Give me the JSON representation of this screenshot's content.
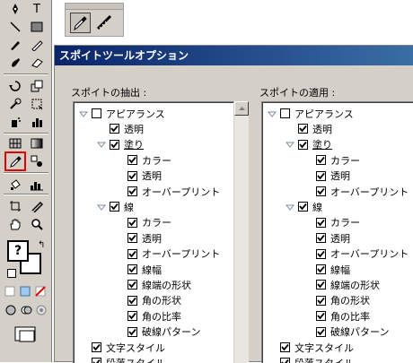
{
  "dialog": {
    "title": "スポイトツールオプション",
    "pick_label": "スポイトの抽出 :",
    "apply_label": "スポイトの適用 :"
  },
  "tree": [
    {
      "label": "アピアランス",
      "checked": false,
      "level": 0,
      "expander": true
    },
    {
      "label": "透明",
      "checked": true,
      "level": 1,
      "expander": false
    },
    {
      "label": "塗り",
      "checked": true,
      "level": 1,
      "expander": true,
      "highlight": true
    },
    {
      "label": "カラー",
      "checked": true,
      "level": 2,
      "expander": false
    },
    {
      "label": "透明",
      "checked": true,
      "level": 2,
      "expander": false
    },
    {
      "label": "オーバープリント",
      "checked": true,
      "level": 2,
      "expander": false
    },
    {
      "label": "線",
      "checked": true,
      "level": 1,
      "expander": true
    },
    {
      "label": "カラー",
      "checked": true,
      "level": 2,
      "expander": false
    },
    {
      "label": "透明",
      "checked": true,
      "level": 2,
      "expander": false
    },
    {
      "label": "オーバープリント",
      "checked": true,
      "level": 2,
      "expander": false
    },
    {
      "label": "線幅",
      "checked": true,
      "level": 2,
      "expander": false
    },
    {
      "label": "線端の形状",
      "checked": true,
      "level": 2,
      "expander": false
    },
    {
      "label": "角の形状",
      "checked": true,
      "level": 2,
      "expander": false
    },
    {
      "label": "角の比率",
      "checked": true,
      "level": 2,
      "expander": false
    },
    {
      "label": "破線パターン",
      "checked": true,
      "level": 2,
      "expander": false
    },
    {
      "label": "文字スタイル",
      "checked": true,
      "level": 0,
      "expander": false
    },
    {
      "label": "段落スタイル",
      "checked": true,
      "level": 0,
      "expander": false
    }
  ],
  "toolbox": {
    "text_tool": "T",
    "help_glyph": "?"
  },
  "colors": {
    "title_start": "#0a246a",
    "title_end": "#3a6ea5",
    "selection_outline": "#e00000",
    "face": "#d4d0c8"
  }
}
